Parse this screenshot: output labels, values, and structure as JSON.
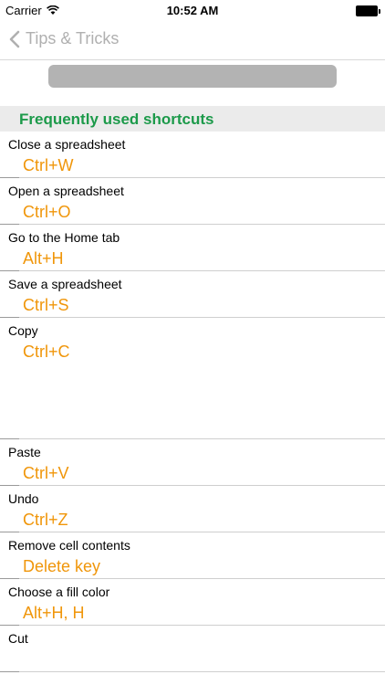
{
  "status_bar": {
    "carrier": "Carrier",
    "time": "10:52 AM"
  },
  "nav": {
    "back_label": "Tips & Tricks"
  },
  "section": {
    "title": "Frequently used shortcuts"
  },
  "shortcuts": [
    {
      "action": "Close a spreadsheet",
      "keys": "Ctrl+W"
    },
    {
      "action": "Open a spreadsheet",
      "keys": "Ctrl+O"
    },
    {
      "action": "Go to the Home tab",
      "keys": "Alt+H"
    },
    {
      "action": "Save a spreadsheet",
      "keys": "Ctrl+S"
    },
    {
      "action": "Copy",
      "keys": "Ctrl+C"
    },
    {
      "action": "Paste",
      "keys": "Ctrl+V"
    },
    {
      "action": "Undo",
      "keys": "Ctrl+Z"
    },
    {
      "action": "Remove cell contents",
      "keys": "Delete key"
    },
    {
      "action": "Choose a fill color",
      "keys": "Alt+H, H"
    },
    {
      "action": "Cut",
      "keys": ""
    }
  ]
}
